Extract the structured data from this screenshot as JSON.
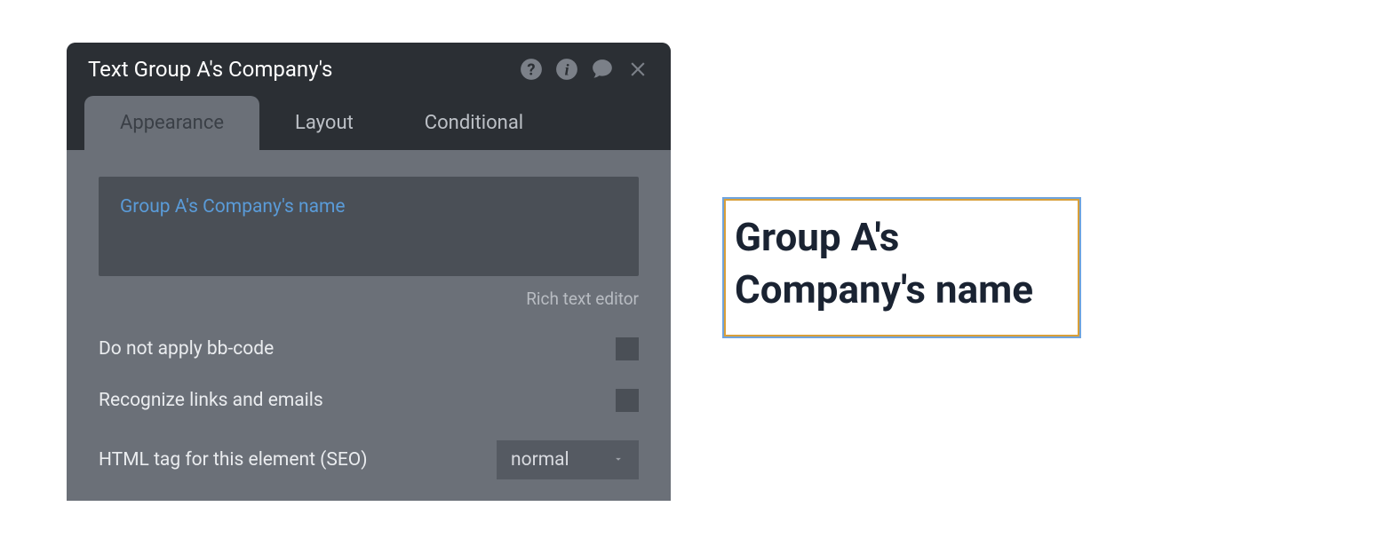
{
  "panel": {
    "title": "Text Group A's Company's",
    "tabs": {
      "appearance": "Appearance",
      "layout": "Layout",
      "conditional": "Conditional"
    },
    "content": {
      "expression": "Group A's Company's name",
      "richTextLink": "Rich text editor",
      "options": {
        "bbcode": "Do not apply bb-code",
        "recognizeLinks": "Recognize links and emails",
        "htmlTag": "HTML tag for this element (SEO)",
        "htmlTagValue": "normal"
      }
    }
  },
  "preview": {
    "text": "Group A's Company's name"
  }
}
